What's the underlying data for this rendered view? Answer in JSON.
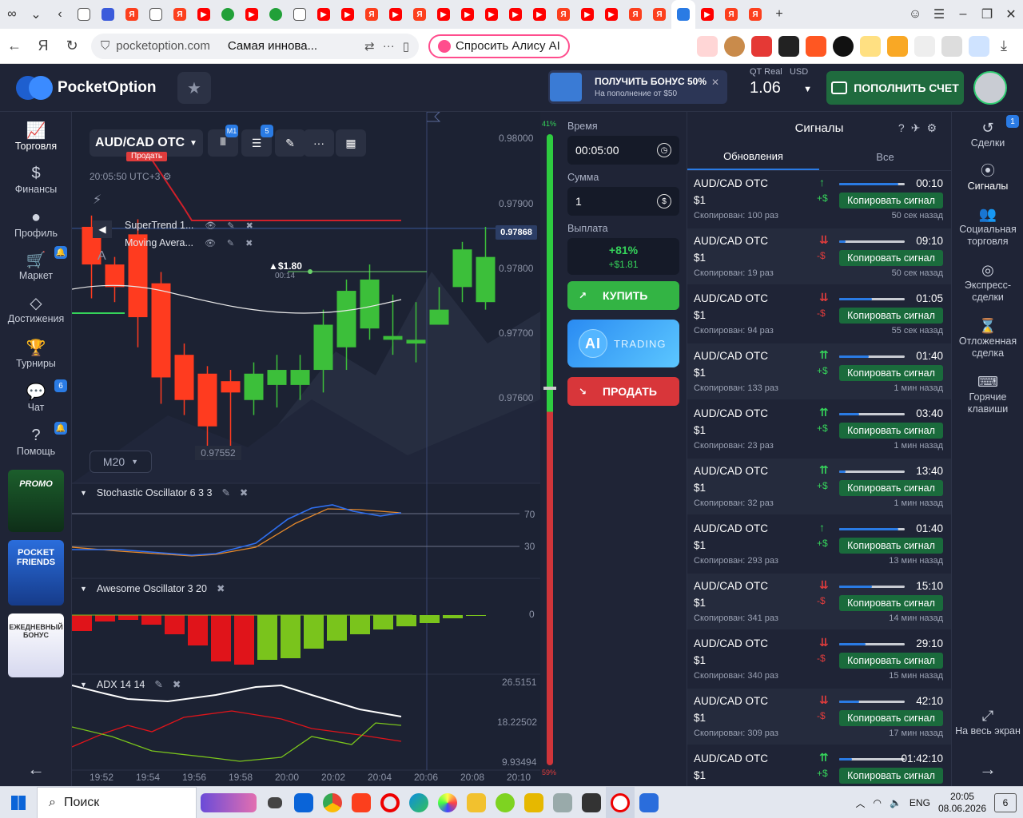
{
  "browser": {
    "url_host": "pocketoption.com",
    "page_title": "Самая иннова...",
    "alice_label": "Спросить Алису AI"
  },
  "header": {
    "logo_text": "PocketOption",
    "bonus_title": "ПОЛУЧИТЬ БОНУС 50%",
    "bonus_sub": "На пополнение от $50",
    "account_type": "QT Real",
    "account_currency": "USD",
    "balance": "1.06",
    "deposit_label": "ПОПОЛНИТЬ СЧЕТ"
  },
  "left_nav": [
    {
      "label": "Торговля",
      "icon": "chart-icon"
    },
    {
      "label": "Финансы",
      "icon": "dollar-icon"
    },
    {
      "label": "Профиль",
      "icon": "user-icon"
    },
    {
      "label": "Маркет",
      "icon": "cart-icon"
    },
    {
      "label": "Достижения",
      "icon": "diamond-icon"
    },
    {
      "label": "Турниры",
      "icon": "trophy-icon"
    },
    {
      "label": "Чат",
      "icon": "chat-icon",
      "badge": "6"
    },
    {
      "label": "Помощь",
      "icon": "help-icon"
    }
  ],
  "promos": {
    "promo": "PROMO",
    "friends": "POCKET FRIENDS",
    "daily": "ЕЖЕДНЕВНЫЙ БОНУС"
  },
  "chart": {
    "pair": "AUD/CAD OTC",
    "timeframe_badge": "M1",
    "indicators_badge": "5",
    "server_time": "20:05:50 UTC+3",
    "sell_marker": "Продать",
    "timeframe": "M20",
    "price_tag": "0.97868",
    "low_tag": "0.97552",
    "trade_amount": "▲$1.80",
    "trade_time": "00:14",
    "indicators": [
      "SuperTrend 1...",
      "Moving Avera..."
    ],
    "price_ticks": [
      "0.98000",
      "0.97900",
      "0.97800",
      "0.97700",
      "0.97600"
    ],
    "stochastic": {
      "label": "Stochastic Oscillator  6 3 3",
      "levels": [
        "70",
        "30"
      ]
    },
    "awesome": {
      "label": "Awesome Oscillator  3 20",
      "zero": "0"
    },
    "adx": {
      "label": "ADX  14 14",
      "ticks": [
        "26.5151",
        "18.22502",
        "9.93494"
      ]
    },
    "times": [
      "19:52",
      "19:54",
      "19:56",
      "19:58",
      "20:00",
      "20:02",
      "20:04",
      "20:06",
      "20:08",
      "20:10"
    ],
    "sentiment_up": "41%",
    "sentiment_down": "59%"
  },
  "chart_data": {
    "type": "candlestick",
    "x": [
      "19:47",
      "19:48",
      "19:49",
      "19:50",
      "19:51",
      "19:52",
      "19:53",
      "19:54",
      "19:55",
      "19:56",
      "19:57",
      "19:58",
      "19:59",
      "20:00",
      "20:01",
      "20:02",
      "20:03",
      "20:04"
    ],
    "candles": [
      [
        0.9787,
        0.97885,
        0.97775,
        0.9782
      ],
      [
        0.9782,
        0.9783,
        0.9777,
        0.9779
      ],
      [
        0.9786,
        0.9788,
        0.9771,
        0.9775
      ],
      [
        0.97795,
        0.9781,
        0.97635,
        0.9767
      ],
      [
        0.977,
        0.97715,
        0.9762,
        0.9764
      ],
      [
        0.97675,
        0.97685,
        0.97575,
        0.97605
      ],
      [
        0.97665,
        0.9768,
        0.9757,
        0.9765
      ],
      [
        0.9764,
        0.9769,
        0.9762,
        0.97675
      ],
      [
        0.9766,
        0.977,
        0.9763,
        0.9768
      ],
      [
        0.9766,
        0.977,
        0.9764,
        0.9768
      ],
      [
        0.9768,
        0.9776,
        0.9765,
        0.9774
      ],
      [
        0.9771,
        0.978,
        0.9768,
        0.97785
      ],
      [
        0.97735,
        0.9782,
        0.9772,
        0.978
      ],
      [
        0.9772,
        0.9778,
        0.977,
        0.97725
      ],
      [
        0.97715,
        0.9777,
        0.9769,
        0.9772
      ],
      [
        0.9774,
        0.9779,
        0.9774,
        0.9776
      ],
      [
        0.9779,
        0.9785,
        0.9777,
        0.9784
      ],
      [
        0.9777,
        0.9787,
        0.9776,
        0.9783
      ]
    ],
    "ylim": [
      0.9754,
      0.9801
    ],
    "sell_line": 0.97875,
    "price_line": 0.97868
  },
  "trade": {
    "time_label": "Время",
    "time_value": "00:05:00",
    "amount_label": "Сумма",
    "amount_value": "1",
    "payout_label": "Выплата",
    "payout_pct": "+81%",
    "payout_amt": "+$1.81",
    "buy_label": "КУПИТЬ",
    "ai_label": "AI",
    "ai_trading": "TRADING",
    "sell_label": "ПРОДАТЬ"
  },
  "signals": {
    "title": "Сигналы",
    "tab_updates": "Обновления",
    "tab_all": "Все",
    "items": [
      {
        "pair": "AUD/CAD OTC",
        "amount": "$1",
        "copied": "Скопирован: 100 раз",
        "dir": "↑",
        "sign": "+$",
        "timer": "00:10",
        "ago": "50 сек назад",
        "btn": "Копировать сигнал",
        "up": true,
        "progress": 0.9
      },
      {
        "pair": "AUD/CAD OTC",
        "amount": "$1",
        "copied": "Скопирован: 19 раз",
        "dir": "⇊",
        "sign": "-$",
        "timer": "09:10",
        "ago": "50 сек назад",
        "btn": "Копировать сигнал",
        "up": false,
        "progress": 0.1
      },
      {
        "pair": "AUD/CAD OTC",
        "amount": "$1",
        "copied": "Скопирован: 94 раз",
        "dir": "⇊",
        "sign": "-$",
        "timer": "01:05",
        "ago": "55 сек назад",
        "btn": "Копировать сигнал",
        "up": false,
        "progress": 0.5
      },
      {
        "pair": "AUD/CAD OTC",
        "amount": "$1",
        "copied": "Скопирован: 133 раз",
        "dir": "⇈",
        "sign": "+$",
        "timer": "01:40",
        "ago": "1 мин назад",
        "btn": "Копировать сигнал",
        "up": true,
        "progress": 0.45
      },
      {
        "pair": "AUD/CAD OTC",
        "amount": "$1",
        "copied": "Скопирован: 23 раз",
        "dir": "⇈",
        "sign": "+$",
        "timer": "03:40",
        "ago": "1 мин назад",
        "btn": "Копировать сигнал",
        "up": true,
        "progress": 0.3
      },
      {
        "pair": "AUD/CAD OTC",
        "amount": "$1",
        "copied": "Скопирован: 32 раз",
        "dir": "⇈",
        "sign": "+$",
        "timer": "13:40",
        "ago": "1 мин назад",
        "btn": "Копировать сигнал",
        "up": true,
        "progress": 0.1
      },
      {
        "pair": "AUD/CAD OTC",
        "amount": "$1",
        "copied": "Скопирован: 293 раз",
        "dir": "↑",
        "sign": "+$",
        "timer": "01:40",
        "ago": "13 мин назад",
        "btn": "Копировать сигнал",
        "up": true,
        "progress": 0.9
      },
      {
        "pair": "AUD/CAD OTC",
        "amount": "$1",
        "copied": "Скопирован: 341 раз",
        "dir": "⇊",
        "sign": "-$",
        "timer": "15:10",
        "ago": "14 мин назад",
        "btn": "Копировать сигнал",
        "up": false,
        "progress": 0.5
      },
      {
        "pair": "AUD/CAD OTC",
        "amount": "$1",
        "copied": "Скопирован: 340 раз",
        "dir": "⇊",
        "sign": "-$",
        "timer": "29:10",
        "ago": "15 мин назад",
        "btn": "Копировать сигнал",
        "up": false,
        "progress": 0.4
      },
      {
        "pair": "AUD/CAD OTC",
        "amount": "$1",
        "copied": "Скопирован: 309 раз",
        "dir": "⇊",
        "sign": "-$",
        "timer": "42:10",
        "ago": "17 мин назад",
        "btn": "Копировать сигнал",
        "up": false,
        "progress": 0.3
      },
      {
        "pair": "AUD/CAD OTC",
        "amount": "$1",
        "copied": "",
        "dir": "⇈",
        "sign": "+$",
        "timer": "01:42:10",
        "ago": "",
        "btn": "Копировать сигнал",
        "up": true,
        "progress": 0.2
      }
    ]
  },
  "right_nav": [
    {
      "label": "Сделки",
      "icon": "history-icon",
      "badge": "1"
    },
    {
      "label": "Сигналы",
      "icon": "signal-icon"
    },
    {
      "label": "Социальная торговля",
      "icon": "social-icon"
    },
    {
      "label": "Экспресс-сделки",
      "icon": "target-icon"
    },
    {
      "label": "Отложенная сделка",
      "icon": "hourglass-icon"
    },
    {
      "label": "Горячие клавиши",
      "icon": "keyboard-icon"
    },
    {
      "label": "На весь экран",
      "icon": "fullscreen-icon"
    }
  ],
  "taskbar": {
    "search": "Поиск",
    "lang": "ENG",
    "time": "20:05",
    "date": "08.06.2026",
    "notif": "6"
  }
}
